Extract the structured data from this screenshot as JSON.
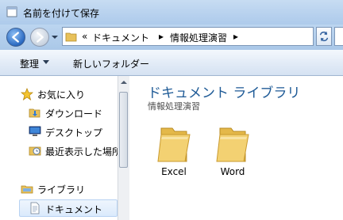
{
  "window": {
    "title": "名前を付けて保存"
  },
  "address": {
    "overflow": "«",
    "path": [
      "ドキュメント",
      "情報処理演習"
    ],
    "separator": "▸"
  },
  "toolbar": {
    "organize_label": "整理",
    "new_folder_label": "新しいフォルダー"
  },
  "navigation": {
    "favorites_label": "お気に入り",
    "favorites_items": [
      "ダウンロード",
      "デスクトップ",
      "最近表示した場所"
    ],
    "libraries_label": "ライブラリ",
    "library_items": [
      "ドキュメント"
    ]
  },
  "content": {
    "library_title": "ドキュメント ライブラリ",
    "library_subtitle": "情報処理演習",
    "folders": [
      "Excel",
      "Word"
    ]
  },
  "colors": {
    "accent": "#1e5a96",
    "folder": "#f3d172"
  }
}
